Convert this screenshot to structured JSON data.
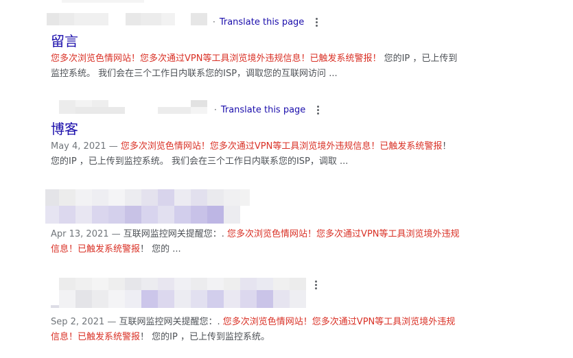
{
  "colors": {
    "link": "#1a0dab",
    "snippet_text": "#4d5156",
    "warning_red": "#d93025",
    "date_gray": "#70757a"
  },
  "icons": {
    "more": "more-vert-icon"
  },
  "results": [
    {
      "translate_label": "Translate this page",
      "title": "留言",
      "date": "",
      "snippet_red": "您多次浏览色情网站！您多次通过VPN等工具浏览境外违规信息！已触发系统警报！",
      "snippet_rest": " 您的IP ，已上传到监控系统。 我们会在三个工作日内联系您的ISP，调取您的互联网访问 ..."
    },
    {
      "translate_label": "Translate this page",
      "title": "博客",
      "date": "May 4, 2021 — ",
      "snippet_red": "您多次浏览色情网站！您多次通过VPN等工具浏览境外违规信息！已触发系统警报",
      "snippet_rest": "！ 您的IP ，已上传到监控系统。 我们会在三个工作日内联系您的ISP，调取 ..."
    },
    {
      "translate_label": "",
      "title": "",
      "date": "Apr 13, 2021 — ",
      "snippet_prefix": "互联网监控网关提醒您：. ",
      "snippet_red": "您多次浏览色情网站！您多次通过VPN等工具浏览境外违规信息！已触发系统警报",
      "snippet_rest": "！ 您的 ..."
    },
    {
      "translate_label": "",
      "title": "",
      "date": "Sep 2, 2021 — ",
      "snippet_prefix": "互联网监控网关提醒您：. ",
      "snippet_red": "您多次浏览色情网站！您多次通过VPN等工具浏览境外违规信息！已触发系统警报",
      "snippet_rest": "！ 您的IP ，已上传到监控系统。"
    }
  ]
}
